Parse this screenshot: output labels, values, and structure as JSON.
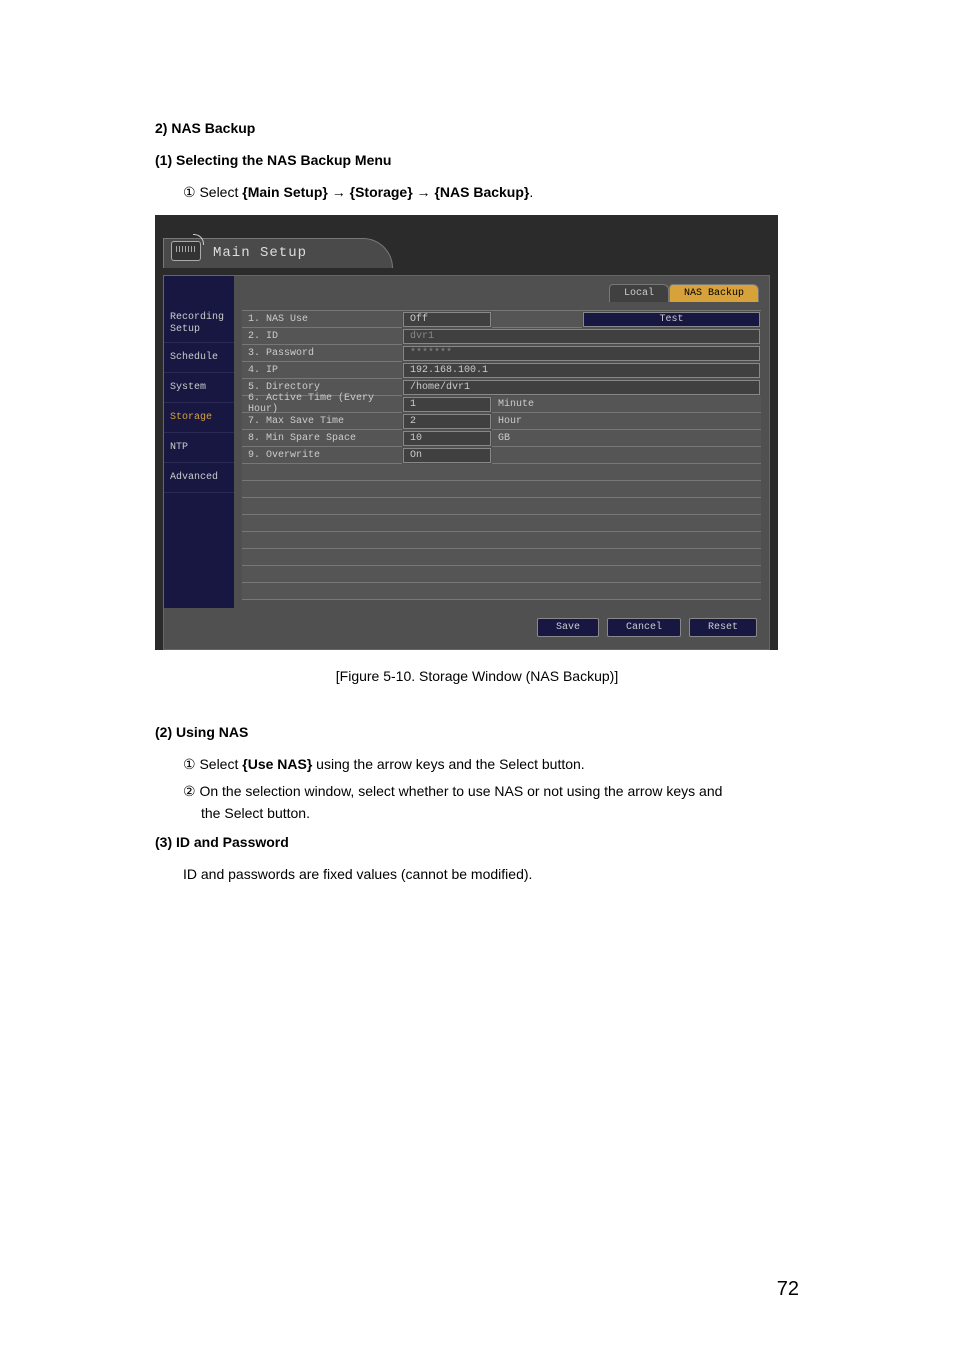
{
  "doc": {
    "h1": "2) NAS Backup",
    "s1_title": "(1)  Selecting the NAS Backup Menu",
    "s1_step_num": "①",
    "s1_step_pre": " Select ",
    "s1_p1": "{Main Setup}",
    "s1_arrow1": " → ",
    "s1_p2": "{Storage}",
    "s1_arrow2": " → ",
    "s1_p3": "{NAS Backup}",
    "s1_step_post": ".",
    "caption": "[Figure 5-10. Storage Window (NAS Backup)]",
    "s2_title": "(2)  Using NAS",
    "s2_step1_num": "①",
    "s2_step1_pre": " Select ",
    "s2_step1_b": "{Use NAS}",
    "s2_step1_post": " using the arrow keys and the Select button.",
    "s2_step2_num": "②",
    "s2_step2_line1": " On the selection window, select whether to use NAS or not using the arrow keys and",
    "s2_step2_line2": "the Select button.",
    "s3_title": "(3)  ID and Password",
    "s3_text": "ID and passwords are fixed values (cannot be modified).",
    "page_num": "72"
  },
  "screenshot": {
    "title": "Main Setup",
    "sidebar": {
      "items": [
        "Recording Setup",
        "Schedule",
        "System",
        "Storage",
        "NTP",
        "Advanced"
      ],
      "active_index": 3
    },
    "tabs": {
      "local": "Local",
      "nas": "NAS Backup"
    },
    "rows": {
      "r1": {
        "label": "1. NAS Use",
        "val": "Off",
        "btn": "Test"
      },
      "r2": {
        "label": "2. ID",
        "val": "dvr1"
      },
      "r3": {
        "label": "3. Password",
        "val": "*******"
      },
      "r4": {
        "label": "4. IP",
        "val": "192.168.100.1"
      },
      "r5": {
        "label": "5. Directory",
        "val": "/home/dvr1"
      },
      "r6": {
        "label": "6. Active Time (Every Hour)",
        "val": "1",
        "unit": "Minute"
      },
      "r7": {
        "label": "7. Max Save Time",
        "val": "2",
        "unit": "Hour"
      },
      "r8": {
        "label": "8. Min Spare Space",
        "val": "10",
        "unit": "GB"
      },
      "r9": {
        "label": "9. Overwrite",
        "val": "On"
      }
    },
    "footer": {
      "save": "Save",
      "cancel": "Cancel",
      "reset": "Reset"
    }
  }
}
